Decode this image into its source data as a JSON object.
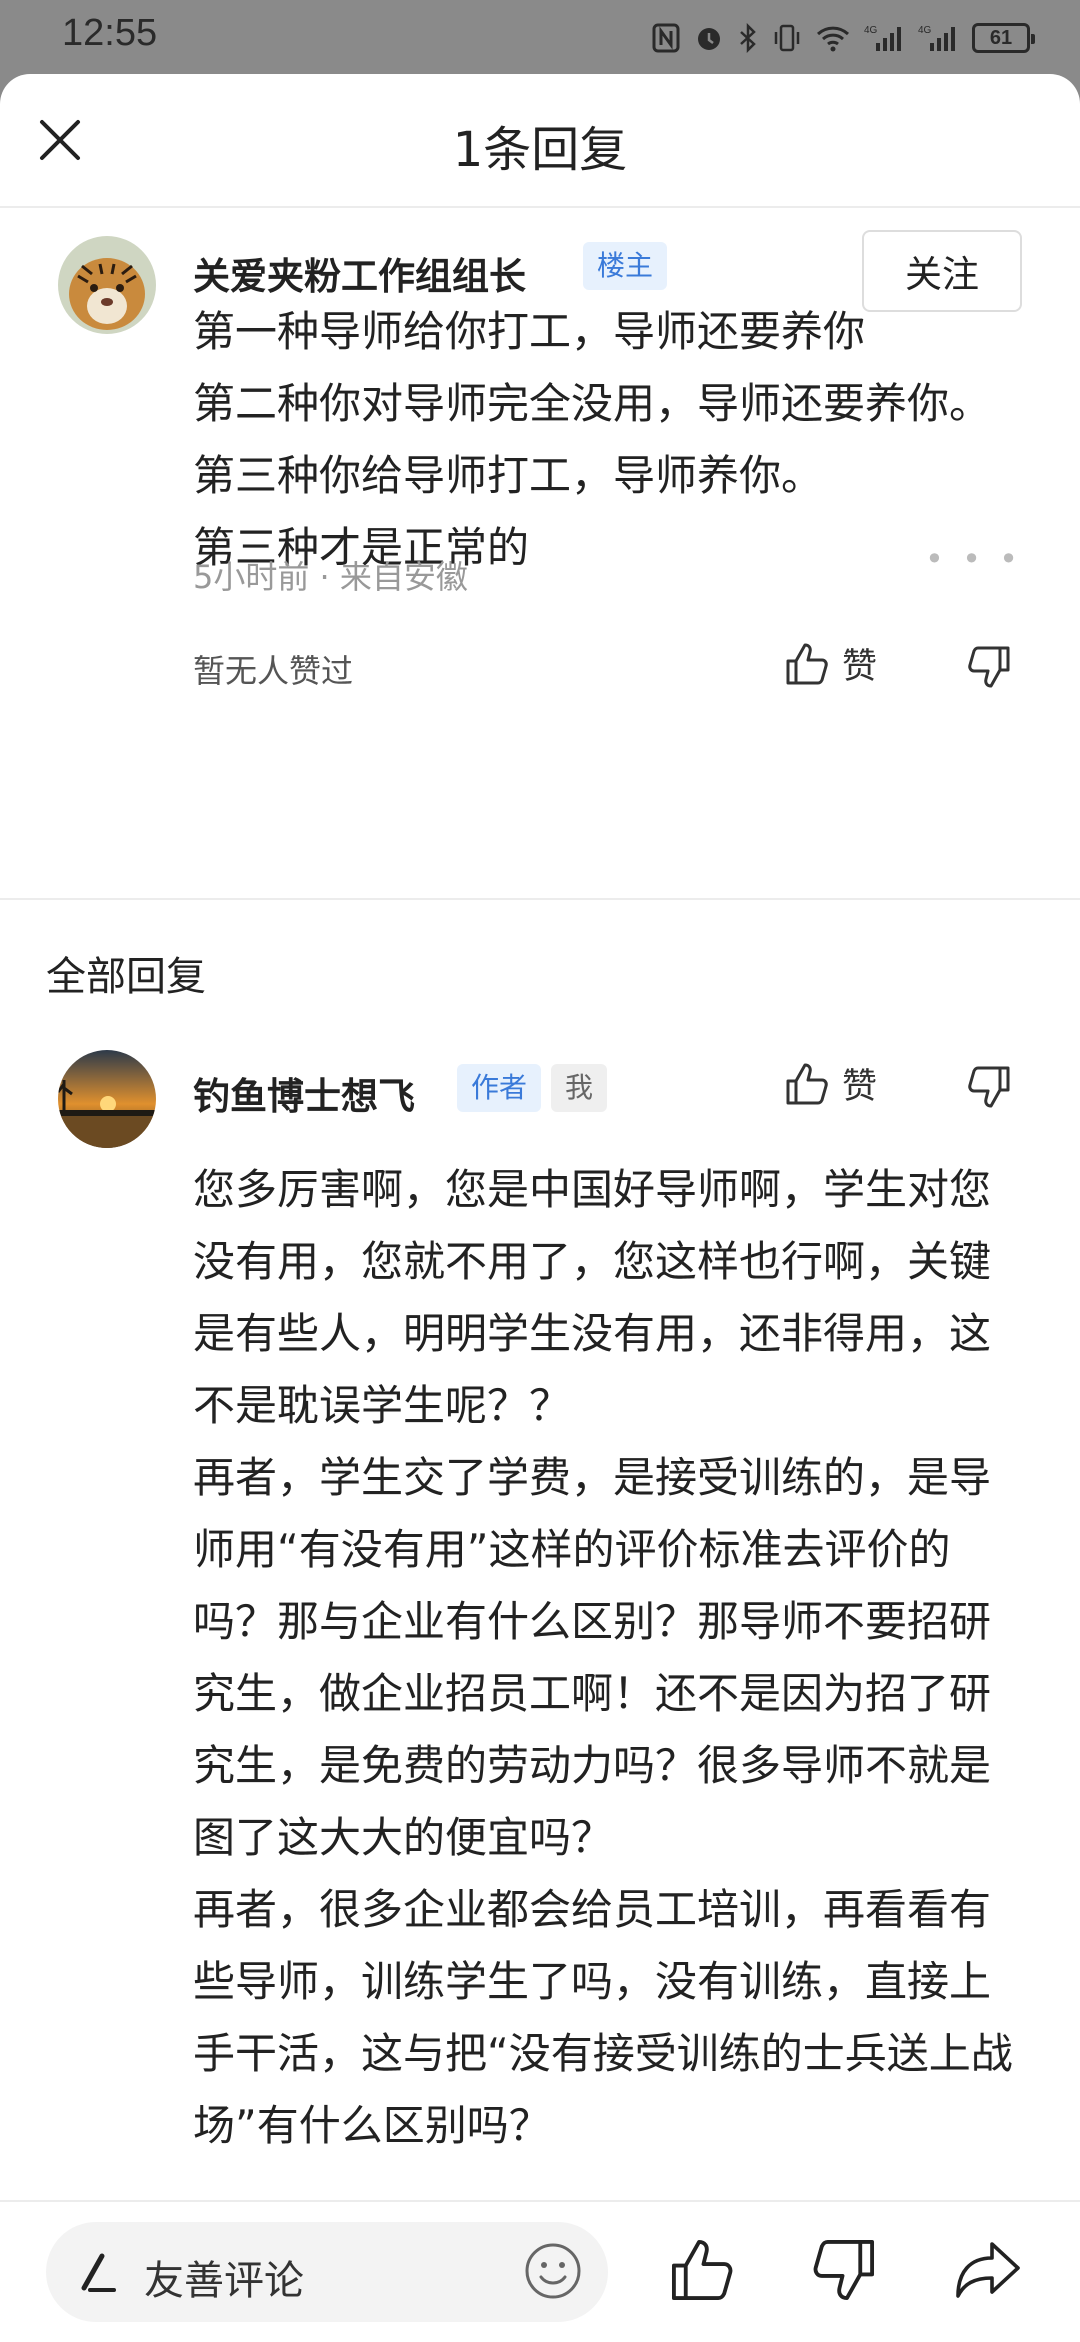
{
  "status": {
    "time": "12:55",
    "battery": "61",
    "net1": "4G",
    "net2": "4G"
  },
  "header": {
    "title": "1条回复"
  },
  "main_comment": {
    "username": "关爱夹粉工作组组长",
    "badge": "楼主",
    "follow_label": "关注",
    "text": "第一种导师给你打工，导师还要养你\n第二种你对导师完全没用，导师还要养你。\n第三种你给导师打工，导师养你。\n第三种才是正常的",
    "meta": "5小时前 · 来自安徽",
    "likes_text": "暂无人赞过",
    "like_label": "赞"
  },
  "replies_section": {
    "title": "全部回复"
  },
  "reply": {
    "username": "钓鱼博士想飞",
    "badge_author": "作者",
    "badge_me": "我",
    "like_label": "赞",
    "text": "您多厉害啊，您是中国好导师啊，学生对您没有用，您就不用了，您这样也行啊，关键是有些人，明明学生没有用，还非得用，这不是耽误学生呢？？\n再者，学生交了学费，是接受训练的，是导师用“有没有用”这样的评价标准去评价的吗？那与企业有什么区别？那导师不要招研究生，做企业招员工啊！还不是因为招了研究生，是免费的劳动力吗？很多导师不就是图了这大大的便宜吗？\n再者，很多企业都会给员工培训，再看看有些导师，训练学生了吗，没有训练，直接上手干活，这与把“没有接受训练的士兵送上战场”有什么区别吗？"
  },
  "bottom": {
    "input_placeholder": "友善评论"
  },
  "colors": {
    "accent_blue": "#3a7ad9",
    "badge_blue_bg": "#e7f1fd",
    "status_bar": "#8a8a8a"
  }
}
